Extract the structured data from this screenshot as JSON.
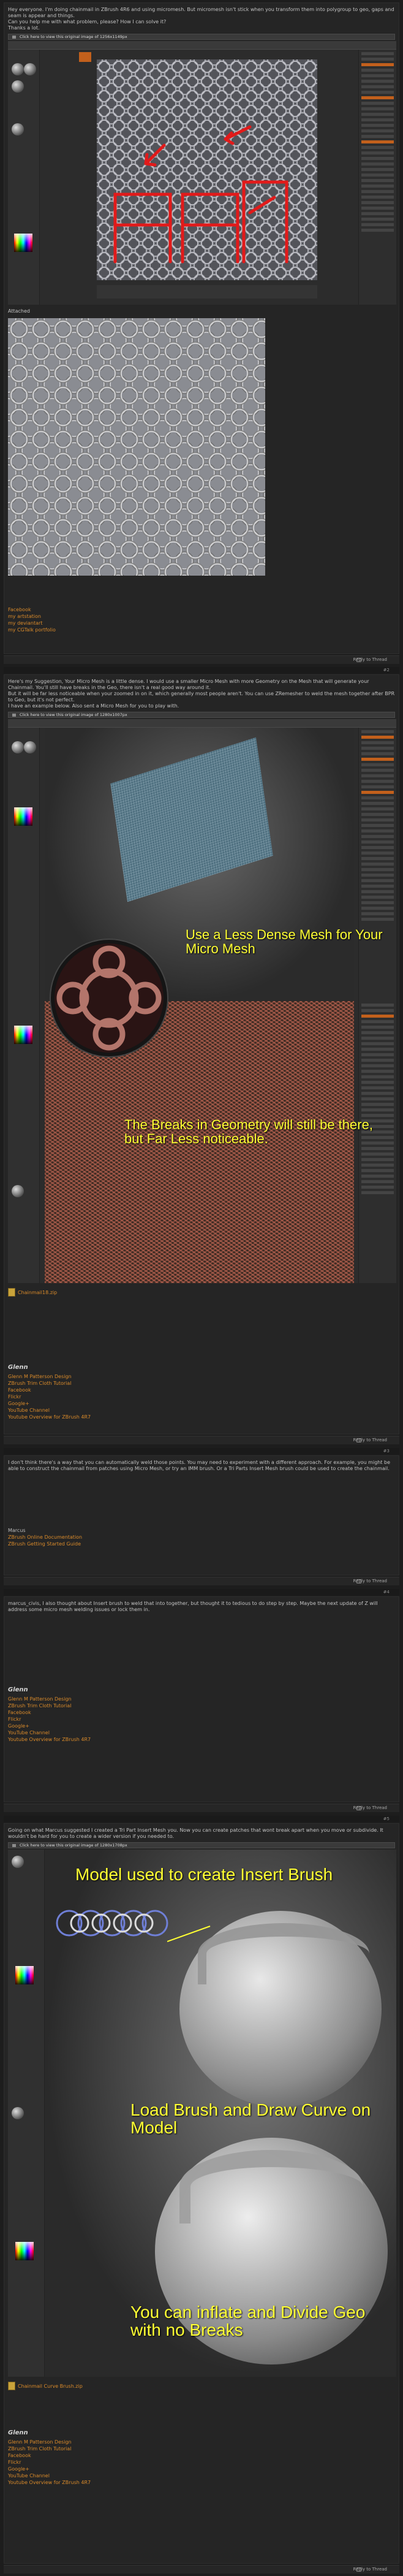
{
  "posts": [
    {
      "number": "#1",
      "body": [
        "Hey everyone. I'm doing chainmail in ZBrush 4R6 and using micromesh. But micromesh isn't stick when you transform them into polygroup to geo, gaps and seam is appear and things.",
        "Can you help me with what problem, please? How I can solve it?",
        "Thanks a lot."
      ],
      "notice": "Click here to view this original image of 1256x1149px",
      "caption": "Attached",
      "signature_links": [
        "Facebook",
        "my artstation",
        "my deviantart",
        "my CGTalk portfolio"
      ],
      "reply": "Reply to Thread"
    },
    {
      "number": "#2",
      "body": [
        "Here's my Suggestion, Your Micro Mesh is a little dense. I would use a smaller Micro Mesh with more Geometry on the Mesh that will generate your Chainmail. You'll still have breaks in the Geo, there isn't a real good way around it.",
        "But it will be far less noticeable when your zoomed in on it, which generally most people aren't. You can use ZRemesher to weld the mesh together after BPR to Geo, but it's not perfect.",
        "I have an example below. Also sent a Micro Mesh for you to play with."
      ],
      "notice": "Click here to view this original image of 1280x1007px",
      "overlay_top": "Use a Less Dense Mesh for Your Micro Mesh",
      "overlay_bottom": "The Breaks in Geometry will still be there, but Far Less noticeable.",
      "attachment": "Chainmail18.zip",
      "signature_name": "Glenn",
      "signature_links": [
        "Glenn M Patterson Design",
        "ZBrush Trim Cloth Tutorial",
        "Facebook",
        "Flickr",
        "Google+",
        "YouTube Channel",
        "Youtube Overview for ZBrush 4R7"
      ],
      "reply": "Reply to Thread"
    },
    {
      "number": "#3",
      "body": [
        "I don't think there's a way that you can automatically weld those points. You may need to experiment with a different approach. For example, you might be able to construct the chainmail from patches using Micro Mesh, or try an IMM brush. Or a Tri Parts Insert Mesh brush could be used to create the chainmail."
      ],
      "signature_links": [
        "Marcus",
        "ZBrush Online Documentation",
        "ZBrush Getting Started Guide"
      ],
      "reply": "Reply to Thread"
    },
    {
      "number": "#4",
      "body": [
        "marcus_civis, I also thought about Insert brush to weld that into together, but thought it to tedious to do step by step. Maybe the next update of Z will address some micro mesh welding issues or lock them in."
      ],
      "signature_name": "Glenn",
      "signature_links": [
        "Glenn M Patterson Design",
        "ZBrush Trim Cloth Tutorial",
        "Facebook",
        "Flickr",
        "Google+",
        "YouTube Channel",
        "Youtube Overview for ZBrush 4R7"
      ],
      "reply": "Reply to Thread"
    },
    {
      "number": "#5",
      "body": [
        "Going on what Marcus suggested I created a Tri Part Insert Mesh you. Now you can create patches that wont break apart when you move or subdivide. It wouldn't be hard for you to create a wider version if you needed to."
      ],
      "notice": "Click here to view this original image of 1280x1708px",
      "overlay_1": "Model used to create Insert Brush",
      "overlay_2": "Load Brush and Draw Curve on Model",
      "overlay_3": "You can inflate and Divide Geo with no Breaks",
      "attachment": "Chainmail Curve Brush.zip",
      "signature_name": "Glenn",
      "signature_links": [
        "Glenn M Patterson Design",
        "ZBrush Trim Cloth Tutorial",
        "Facebook",
        "Flickr",
        "Google+",
        "YouTube Channel",
        "Youtube Overview for ZBrush 4R7"
      ],
      "reply": "Reply to Thread"
    }
  ],
  "colors": {
    "accent": "#d98a2a",
    "overlay": "#ffff33",
    "annotation_red": "#e21a1a"
  }
}
